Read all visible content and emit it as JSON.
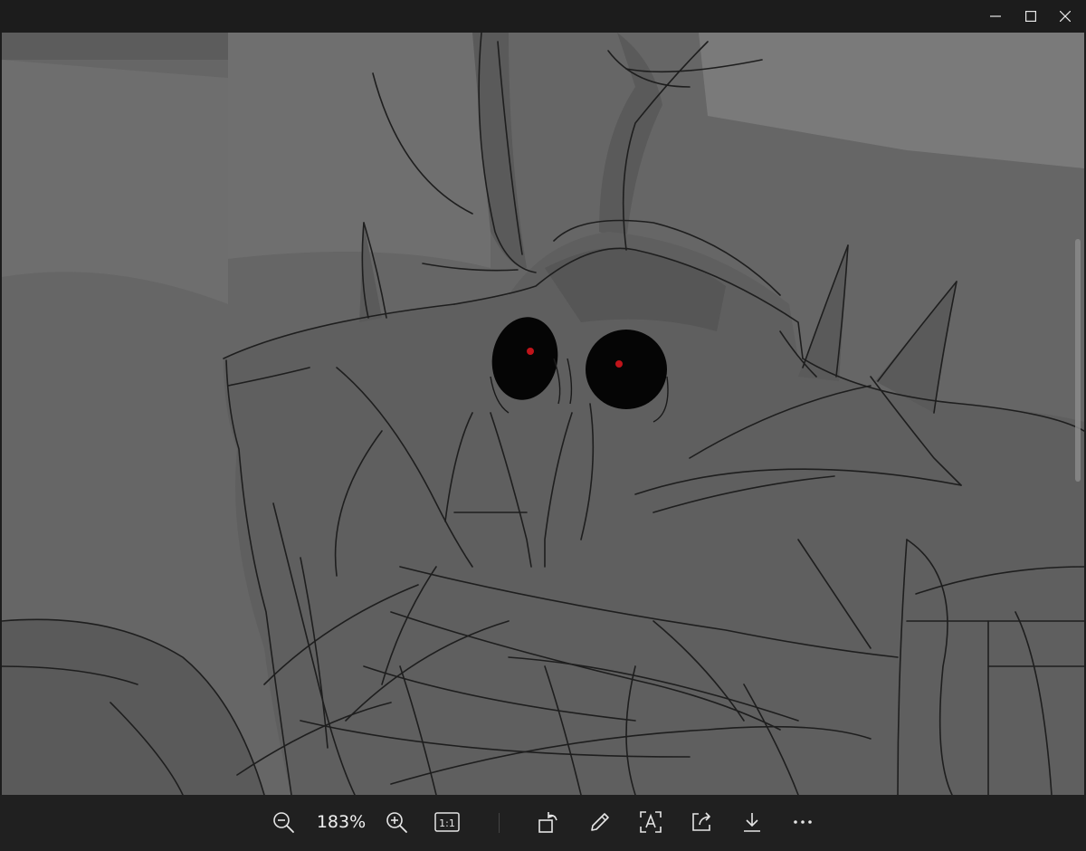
{
  "window": {
    "controls": {
      "minimize_icon": "minimize-icon",
      "maximize_icon": "maximize-icon",
      "close_icon": "close-icon"
    }
  },
  "image": {
    "description_icon": "sketch-image",
    "eye_color": "#c0141a",
    "background_color": "#6b6b6b"
  },
  "toolbar": {
    "zoom_level": "183%",
    "actual_size_label": "1:1",
    "icons": [
      "zoom-out-icon",
      "zoom-in-icon",
      "actual-size-icon",
      "rotate-icon",
      "edit-icon",
      "text-recognition-icon",
      "share-icon",
      "save-icon",
      "more-icon"
    ]
  }
}
